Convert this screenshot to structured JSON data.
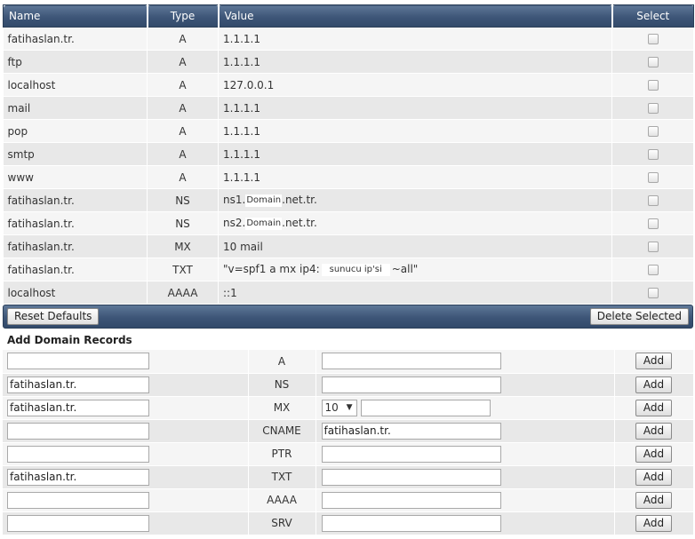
{
  "records_table": {
    "headers": {
      "name": "Name",
      "type": "Type",
      "value": "Value",
      "select": "Select"
    },
    "rows": [
      {
        "name": "fatihaslan.tr.",
        "type": "A",
        "value": "1.1.1.1"
      },
      {
        "name": "ftp",
        "type": "A",
        "value": "1.1.1.1"
      },
      {
        "name": "localhost",
        "type": "A",
        "value": "127.0.0.1"
      },
      {
        "name": "mail",
        "type": "A",
        "value": "1.1.1.1"
      },
      {
        "name": "pop",
        "type": "A",
        "value": "1.1.1.1"
      },
      {
        "name": "smtp",
        "type": "A",
        "value": "1.1.1.1"
      },
      {
        "name": "www",
        "type": "A",
        "value": "1.1.1.1"
      },
      {
        "name": "fatihaslan.tr.",
        "type": "NS",
        "value_prefix": "ns1.",
        "value_chip": "Domain",
        "value_suffix": ".net.tr."
      },
      {
        "name": "fatihaslan.tr.",
        "type": "NS",
        "value_prefix": "ns2.",
        "value_chip": "Domain",
        "value_suffix": ".net.tr."
      },
      {
        "name": "fatihaslan.tr.",
        "type": "MX",
        "value": "10 mail"
      },
      {
        "name": "fatihaslan.tr.",
        "type": "TXT",
        "value_prefix": "\"v=spf1 a mx ip4:",
        "value_chip": "sunucu ip'si",
        "value_suffix": "~all\""
      },
      {
        "name": "localhost",
        "type": "AAAA",
        "value": "::1"
      }
    ]
  },
  "actions": {
    "reset_label": "Reset Defaults",
    "delete_label": "Delete Selected"
  },
  "add_section": {
    "title": "Add Domain Records",
    "add_label": "Add",
    "rows": [
      {
        "name_value": "",
        "type": "A",
        "value": ""
      },
      {
        "name_value": "fatihaslan.tr.",
        "type": "NS",
        "value": ""
      },
      {
        "name_value": "fatihaslan.tr.",
        "type": "MX",
        "priority": "10",
        "value": ""
      },
      {
        "name_value": "",
        "type": "CNAME",
        "value": "fatihaslan.tr."
      },
      {
        "name_value": "",
        "type": "PTR",
        "value": ""
      },
      {
        "name_value": "fatihaslan.tr.",
        "type": "TXT",
        "value": ""
      },
      {
        "name_value": "",
        "type": "AAAA",
        "value": ""
      },
      {
        "name_value": "",
        "type": "SRV",
        "value": ""
      }
    ]
  },
  "colors": {
    "header_bar": "#3d5577",
    "row_light": "#f5f5f5",
    "row_dark": "#e8e8e8"
  }
}
